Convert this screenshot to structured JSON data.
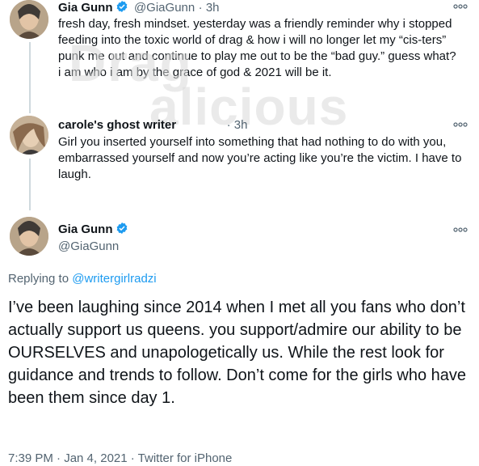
{
  "tweets": [
    {
      "name": "Gia Gunn",
      "handle": "@GiaGunn",
      "time": "· 3h",
      "text": "fresh day, fresh mindset.  yesterday was a friendly reminder why i stopped feeding into the toxic world of drag & how i will no longer let my “cis-ters” punk me out and continue to play me out to be the “bad guy.” guess what? i am who i am by the grace of god & 2021 will be it."
    },
    {
      "name": "carole's ghost writer",
      "handle": "",
      "time": "· 3h",
      "text": "Girl you inserted yourself into something that had nothing to do with you, embarrassed yourself and now you’re acting like you’re the victim. I have to laugh."
    }
  ],
  "main_tweet": {
    "name": "Gia Gunn",
    "handle": "@GiaGunn",
    "replying_prefix": "Replying to ",
    "replying_to": "@writergirlradzi",
    "text": "I’ve been laughing since 2014 when I met all you fans who don’t actually support us queens. you support/admire our ability to be OURSELVES and unapologetically us.  While the rest look for guidance and trends to follow. Don’t come for the girls who have been them since day 1.",
    "timestamp": "7:39 PM · Jan 4, 2021 · Twitter for iPhone"
  },
  "watermark": "Dragalicious",
  "colors": {
    "verified": "#1d9bf0",
    "link": "#1d9bf0",
    "secondary": "#536471"
  }
}
